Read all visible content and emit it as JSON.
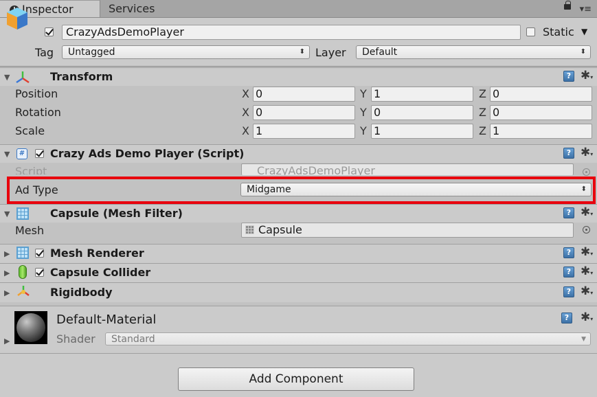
{
  "tabs": [
    {
      "label": "Inspector",
      "active": true
    },
    {
      "label": "Services",
      "active": false
    }
  ],
  "icons": {
    "info": "i",
    "menu": "▾≡",
    "help": "?",
    "gear": "✱",
    "gear_caret": "▾",
    "fold_open": "▼",
    "fold_closed": "▶",
    "dd_arrow": "⬍"
  },
  "object": {
    "name": "CrazyAdsDemoPlayer",
    "active": true,
    "static_label": "Static",
    "tag_label": "Tag",
    "tag_value": "Untagged",
    "layer_label": "Layer",
    "layer_value": "Default"
  },
  "transform": {
    "title": "Transform",
    "rows": [
      {
        "label": "Position",
        "x": "0",
        "y": "1",
        "z": "0"
      },
      {
        "label": "Rotation",
        "x": "0",
        "y": "0",
        "z": "0"
      },
      {
        "label": "Scale",
        "x": "1",
        "y": "1",
        "z": "1"
      }
    ],
    "axis_x": "X",
    "axis_y": "Y",
    "axis_z": "Z"
  },
  "script_component": {
    "title": "Crazy Ads Demo Player (Script)",
    "enabled": true,
    "script_label": "Script",
    "script_value": "CrazyAdsDemoPlayer",
    "ad_type_label": "Ad Type",
    "ad_type_value": "Midgame"
  },
  "mesh_filter": {
    "title": "Capsule (Mesh Filter)",
    "mesh_label": "Mesh",
    "mesh_value": "Capsule"
  },
  "mesh_renderer": {
    "title": "Mesh Renderer",
    "enabled": true
  },
  "capsule_collider": {
    "title": "Capsule Collider",
    "enabled": true
  },
  "rigidbody": {
    "title": "Rigidbody"
  },
  "material": {
    "name": "Default-Material",
    "shader_label": "Shader",
    "shader_value": "Standard"
  },
  "add_component_label": "Add Component",
  "colors": {
    "highlight": "#e8000d",
    "help_blue": "#3d71a6",
    "panel": "#cbcbcb"
  }
}
